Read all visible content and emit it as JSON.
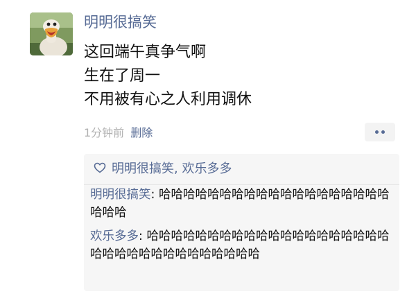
{
  "post": {
    "author_name": "明明很搞笑",
    "avatar_icon": "duck-avatar-icon",
    "lines": [
      "这回端午真争气啊",
      "生在了周一",
      "不用被有心之人利用调休"
    ],
    "time": "1分钟前",
    "delete_label": "删除",
    "more_icon": "more-dots-icon"
  },
  "likes": {
    "icon": "heart-outline-icon",
    "names": "明明很搞笑, 欢乐多多"
  },
  "comments": [
    {
      "author": "明明很搞笑",
      "separator": ": ",
      "text": "哈哈哈哈哈哈哈哈哈哈哈哈哈哈哈哈哈哈哈哈哈哈"
    },
    {
      "author": "欢乐多多",
      "separator": ": ",
      "text": "哈哈哈哈哈哈哈哈哈哈哈哈哈哈哈哈哈哈哈哈哈哈哈哈哈哈哈哈哈哈哈哈哈哈"
    }
  ],
  "colors": {
    "link": "#576b95",
    "text": "#111111",
    "muted": "#b2b2b2",
    "comment_bg": "#f6f6f6"
  }
}
